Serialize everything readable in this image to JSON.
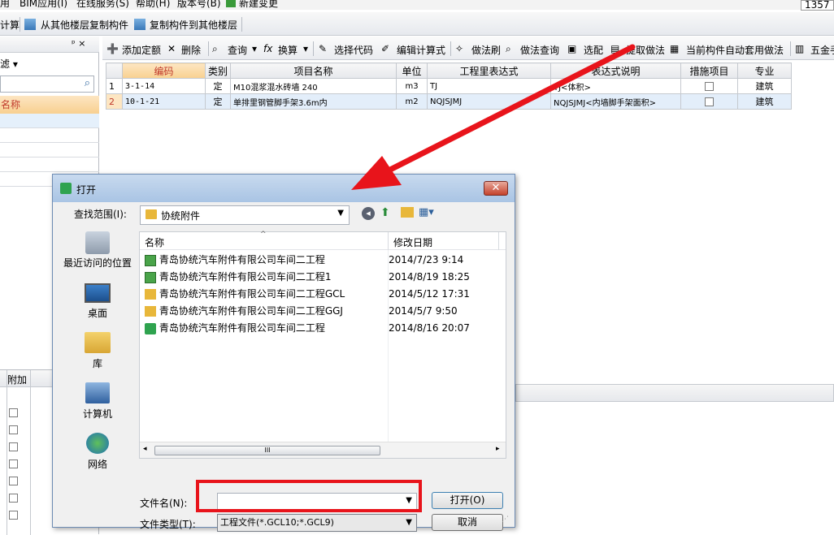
{
  "menubar": {
    "items": [
      "用",
      "BIM应用(I)",
      "在线服务(S)",
      "帮助(H)",
      "版本号(B)",
      "新建变更"
    ],
    "corner_text": "1357"
  },
  "toolbar2": {
    "items": [
      "计算",
      "从其他楼层复制构件",
      "复制构件到其他楼层"
    ]
  },
  "leftpanel": {
    "filter_label": "滤",
    "name_header": "名称",
    "lower_header": "附加"
  },
  "grid_toolbar": {
    "pin": "ᵖ ×",
    "items": [
      "添加定额",
      "删除",
      "查询",
      "换算",
      "选择代码",
      "编辑计算式",
      "做法刷",
      "做法查询",
      "选配",
      "提取做法",
      "当前构件自动套用做法",
      "五金手"
    ]
  },
  "grid": {
    "headers": [
      "编码",
      "类别",
      "项目名称",
      "单位",
      "工程里表达式",
      "表达式说明",
      "措施项目",
      "专业"
    ],
    "rows": [
      {
        "idx": "1",
        "code": "3-1-14",
        "type": "定",
        "name": "M10混浆混水砖墙 240",
        "unit": "m3",
        "expr": "TJ",
        "desc": "TJ<体积>",
        "major": "建筑"
      },
      {
        "idx": "2",
        "code": "10-1-21",
        "type": "定",
        "name": "单排里钢管脚手架3.6m内",
        "unit": "m2",
        "expr": "NQJSJMJ",
        "desc": "NQJSJMJ<内墙脚手架面积>",
        "major": "建筑"
      }
    ]
  },
  "dialog": {
    "title": "打开",
    "close": "✕",
    "lookin_label": "查找范围(I):",
    "lookin_value": "协统附件",
    "places": [
      "最近访问的位置",
      "桌面",
      "库",
      "计算机",
      "网络"
    ],
    "columns": [
      "名称",
      "修改日期"
    ],
    "files": [
      {
        "name": "青岛协统汽车附件有限公司车间二工程",
        "date": "2014/7/23 9:14",
        "kind": "app"
      },
      {
        "name": "青岛协统汽车附件有限公司车间二工程1",
        "date": "2014/8/19 18:25",
        "kind": "app"
      },
      {
        "name": "青岛协统汽车附件有限公司车间二工程GCL",
        "date": "2014/5/12 17:31",
        "kind": "folder"
      },
      {
        "name": "青岛协统汽车附件有限公司车间二工程GGJ",
        "date": "2014/5/7 9:50",
        "kind": "folder"
      },
      {
        "name": "青岛协统汽车附件有限公司车间二工程",
        "date": "2014/8/16 20:07",
        "kind": "green"
      }
    ],
    "filename_label": "文件名(N):",
    "filename_value": "",
    "filetype_label": "文件类型(T):",
    "filetype_value": "工程文件(*.GCL10;*.GCL9)",
    "open_button": "打开(O)",
    "cancel_button": "取消",
    "scroll_grip": "III"
  },
  "colors": {
    "highlight": "#e8141b",
    "header_orange": "#f8d090",
    "accent_blue": "#3c7fb1"
  }
}
